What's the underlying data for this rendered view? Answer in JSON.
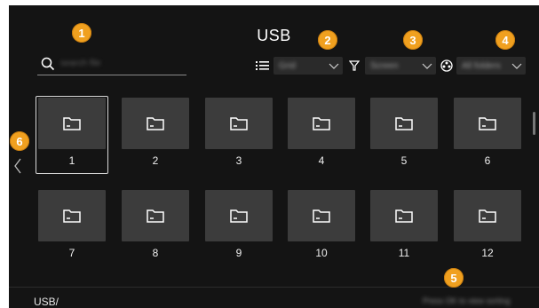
{
  "header": {
    "title": "USB"
  },
  "search": {
    "placeholder": "search file",
    "icon": "search-icon"
  },
  "controls": {
    "view": {
      "icon": "list-icon",
      "value": "Grid"
    },
    "filter": {
      "icon": "filter-icon",
      "value": "Screen"
    },
    "source": {
      "icon": "source-icon",
      "value": "All folders"
    }
  },
  "folders": [
    {
      "label": "1"
    },
    {
      "label": "2"
    },
    {
      "label": "3"
    },
    {
      "label": "4"
    },
    {
      "label": "5"
    },
    {
      "label": "6"
    },
    {
      "label": "7"
    },
    {
      "label": "8"
    },
    {
      "label": "9"
    },
    {
      "label": "10"
    },
    {
      "label": "11"
    },
    {
      "label": "12"
    }
  ],
  "footer": {
    "path": "USB/",
    "hint": "Press OK to view sorting"
  },
  "callouts": [
    "1",
    "2",
    "3",
    "4",
    "5",
    "6"
  ],
  "colors": {
    "background": "#141414",
    "tile": "#3c3c3c",
    "callout": "#f0a01f",
    "focus_border": "#d8d8d8"
  }
}
